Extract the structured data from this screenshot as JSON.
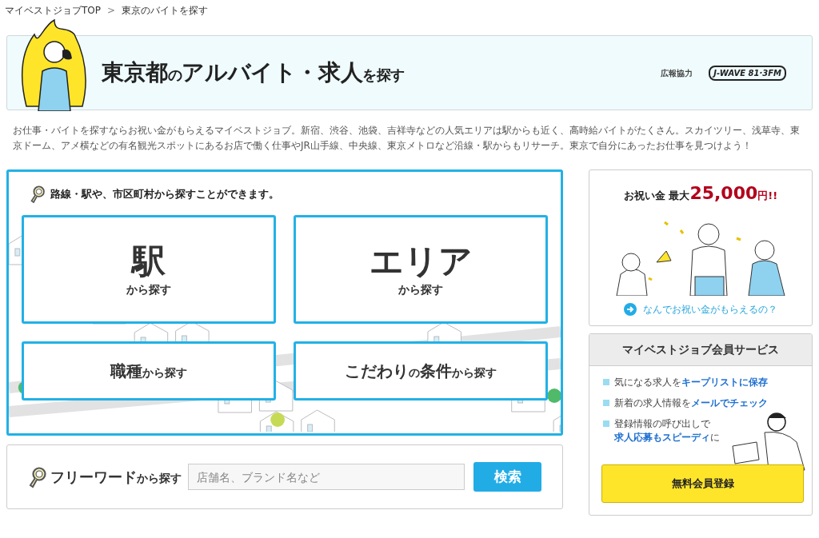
{
  "breadcrumb": [
    {
      "label": "マイベストジョブTOP"
    },
    {
      "label": "東京のバイトを探す"
    }
  ],
  "breadcrumb_separator": ">",
  "banner": {
    "title_parts": [
      {
        "text": "東京都",
        "kind": "large"
      },
      {
        "text": "の",
        "kind": "small"
      },
      {
        "text": "アルバイト・求人",
        "kind": "large"
      },
      {
        "text": "を探す",
        "kind": "small"
      }
    ],
    "sponsor_label": "広報協力",
    "sponsor_logo": "J-WAVE 81·3FM"
  },
  "description": "お仕事・バイトを探すならお祝い金がもらえるマイベストジョブ。新宿、渋谷、池袋、吉祥寺などの人気エリアは駅からも近く、高時給バイトがたくさん。スカイツリー、浅草寺、東京ドーム、アメ横などの有名観光スポットにあるお店で働く仕事やJR山手線、中央線、東京メトロなど沿線・駅からもリサーチ。東京で自分にあったお仕事を見つけよう！",
  "search_panel": {
    "heading": "路線・駅や、市区町村から探すことができます。",
    "tiles": [
      {
        "kind": "large",
        "parts": [
          {
            "text": "駅",
            "kind": "main"
          },
          {
            "text": "から探す",
            "kind": "sub"
          }
        ]
      },
      {
        "kind": "large",
        "parts": [
          {
            "text": "エリア",
            "kind": "main"
          },
          {
            "text": "から探す",
            "kind": "sub"
          }
        ]
      },
      {
        "kind": "inline",
        "parts": [
          {
            "text": "職種",
            "kind": "main"
          },
          {
            "text": "から探す",
            "kind": "sub"
          }
        ]
      },
      {
        "kind": "inline",
        "parts": [
          {
            "text": "こだわり",
            "kind": "main"
          },
          {
            "text": "の",
            "kind": "sub"
          },
          {
            "text": "条件",
            "kind": "main"
          },
          {
            "text": "から探す",
            "kind": "sub"
          }
        ]
      }
    ]
  },
  "freeword": {
    "label_parts": [
      {
        "text": "フリーワード",
        "kind": "main"
      },
      {
        "text": "から探す",
        "kind": "sub"
      }
    ],
    "placeholder": "店舗名、ブランド名など",
    "button": "検索"
  },
  "bonus_card": {
    "title_parts": [
      {
        "text": "お祝い金 最大",
        "kind": "plain"
      },
      {
        "text": "25,000",
        "kind": "amount"
      },
      {
        "text": "円!!",
        "kind": "unit"
      }
    ],
    "link": "なんでお祝い金がもらえるの？"
  },
  "member_card": {
    "title": "マイベストジョブ会員サービス",
    "items": [
      {
        "parts": [
          {
            "text": "気になる求人を",
            "kind": "plain"
          },
          {
            "text": "キープリストに保存",
            "kind": "emphasis"
          }
        ]
      },
      {
        "parts": [
          {
            "text": "新着の求人情報を",
            "kind": "plain"
          },
          {
            "text": "メールでチェック",
            "kind": "emphasis"
          }
        ]
      },
      {
        "parts": [
          {
            "text": "登録情報の呼び出しで",
            "kind": "plain"
          },
          {
            "kind": "break"
          },
          {
            "text": "求人応募もスピーディ",
            "kind": "emphasis"
          },
          {
            "text": "に",
            "kind": "plain"
          }
        ]
      }
    ],
    "button": "無料会員登録"
  }
}
